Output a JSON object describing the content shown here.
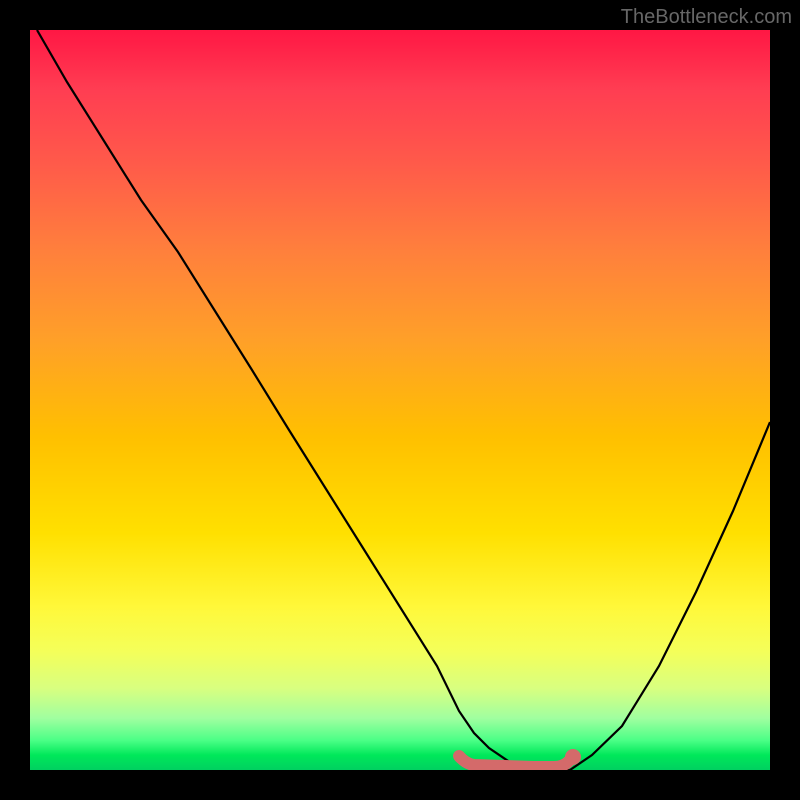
{
  "watermark": "TheBottleneck.com",
  "chart_data": {
    "type": "line",
    "title": "",
    "xlabel": "",
    "ylabel": "",
    "xlim": [
      0,
      100
    ],
    "ylim": [
      0,
      100
    ],
    "grid": false,
    "legend": false,
    "gradient_stops": [
      {
        "pos": 0,
        "color": "#ff1744"
      },
      {
        "pos": 8,
        "color": "#ff3d52"
      },
      {
        "pos": 18,
        "color": "#ff5a4a"
      },
      {
        "pos": 30,
        "color": "#ff803c"
      },
      {
        "pos": 42,
        "color": "#ffa028"
      },
      {
        "pos": 55,
        "color": "#ffc000"
      },
      {
        "pos": 68,
        "color": "#ffe000"
      },
      {
        "pos": 78,
        "color": "#fff83a"
      },
      {
        "pos": 84,
        "color": "#f4ff5a"
      },
      {
        "pos": 89,
        "color": "#d8ff80"
      },
      {
        "pos": 93,
        "color": "#a0ffa0"
      },
      {
        "pos": 96,
        "color": "#4bff86"
      },
      {
        "pos": 98,
        "color": "#00e85a"
      },
      {
        "pos": 100,
        "color": "#00d060"
      }
    ],
    "series": [
      {
        "name": "bottleneck-curve",
        "color": "#000000",
        "x": [
          1,
          5,
          10,
          15,
          20,
          25,
          30,
          35,
          40,
          45,
          50,
          55,
          58,
          60,
          62,
          65,
          68,
          70,
          73,
          76,
          80,
          85,
          90,
          95,
          100
        ],
        "y": [
          100,
          93,
          85,
          77,
          70,
          62,
          54,
          46,
          38,
          30,
          22,
          14,
          8,
          5,
          3,
          1,
          0,
          0,
          0,
          2,
          6,
          14,
          24,
          35,
          47
        ]
      }
    ],
    "marker_band": {
      "name": "highlight-band",
      "color": "#d46a6a",
      "x_range": [
        58,
        73
      ],
      "y": 0,
      "end_dot_x": 73
    }
  }
}
